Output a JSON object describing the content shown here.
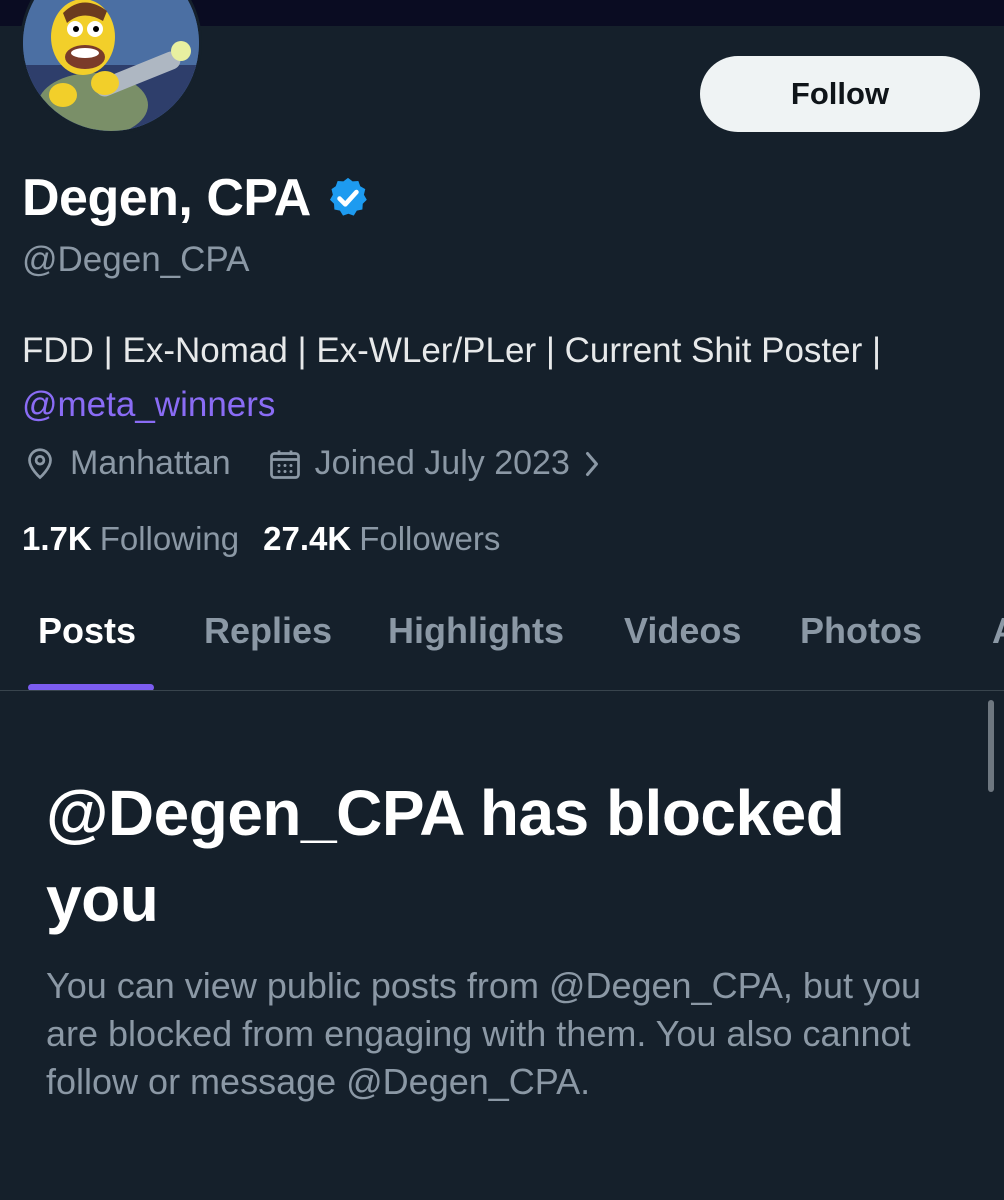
{
  "profile": {
    "display_name": "Degen, CPA",
    "handle": "@Degen_CPA",
    "bio_text": "FDD | Ex-Nomad | Ex-WLer/PLer | Current Shit Poster |",
    "bio_link": "@meta_winners",
    "location": "Manhattan",
    "joined": "Joined July 2023",
    "avatar_icon": "cartoon-avatar",
    "verified_icon": "verified-badge-icon"
  },
  "actions": {
    "follow_label": "Follow"
  },
  "stats": {
    "following_count": "1.7K",
    "following_label": "Following",
    "followers_count": "27.4K",
    "followers_label": "Followers"
  },
  "tabs": [
    {
      "label": "Posts",
      "active": true
    },
    {
      "label": "Replies",
      "active": false
    },
    {
      "label": "Highlights",
      "active": false
    },
    {
      "label": "Videos",
      "active": false
    },
    {
      "label": "Photos",
      "active": false
    },
    {
      "label": "A",
      "active": false
    }
  ],
  "blocked": {
    "title": "@Degen_CPA has blocked you",
    "message": "You can view public posts from @Degen_CPA, but you are blocked from engaging with them. You also cannot follow or message @Degen_CPA."
  },
  "colors": {
    "background": "#15202b",
    "accent": "#7b5cf0",
    "link": "#8a6cf5",
    "verified": "#1d9bf0",
    "muted_text": "#8b98a5"
  }
}
